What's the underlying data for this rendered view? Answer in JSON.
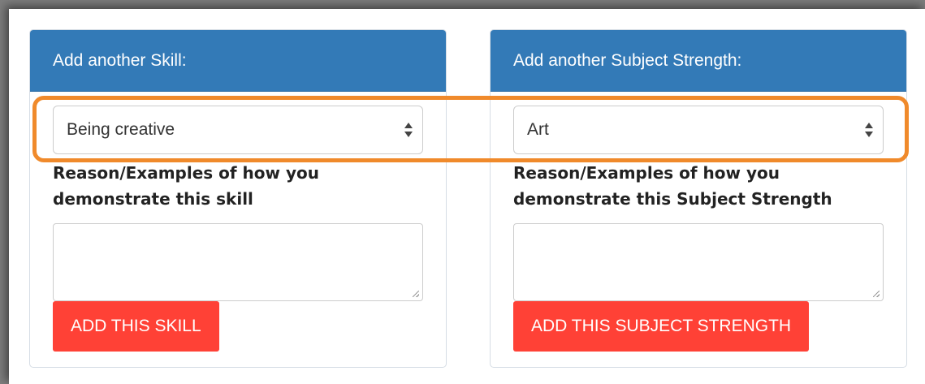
{
  "skill_panel": {
    "header": "Add another Skill:",
    "selected": "Being creative",
    "reason_label": "Reason/Examples of how you demonstrate this skill",
    "reason_value": "",
    "button_label": "ADD THIS SKILL"
  },
  "subject_panel": {
    "header": "Add another Subject Strength:",
    "selected": "Art",
    "reason_label": "Reason/Examples of how you demonstrate this Subject Strength",
    "reason_value": "",
    "button_label": "ADD THIS SUBJECT STRENGTH"
  },
  "colors": {
    "header_blue": "#337ab7",
    "button_red": "#ff4136",
    "highlight_orange": "#f08a2b"
  }
}
